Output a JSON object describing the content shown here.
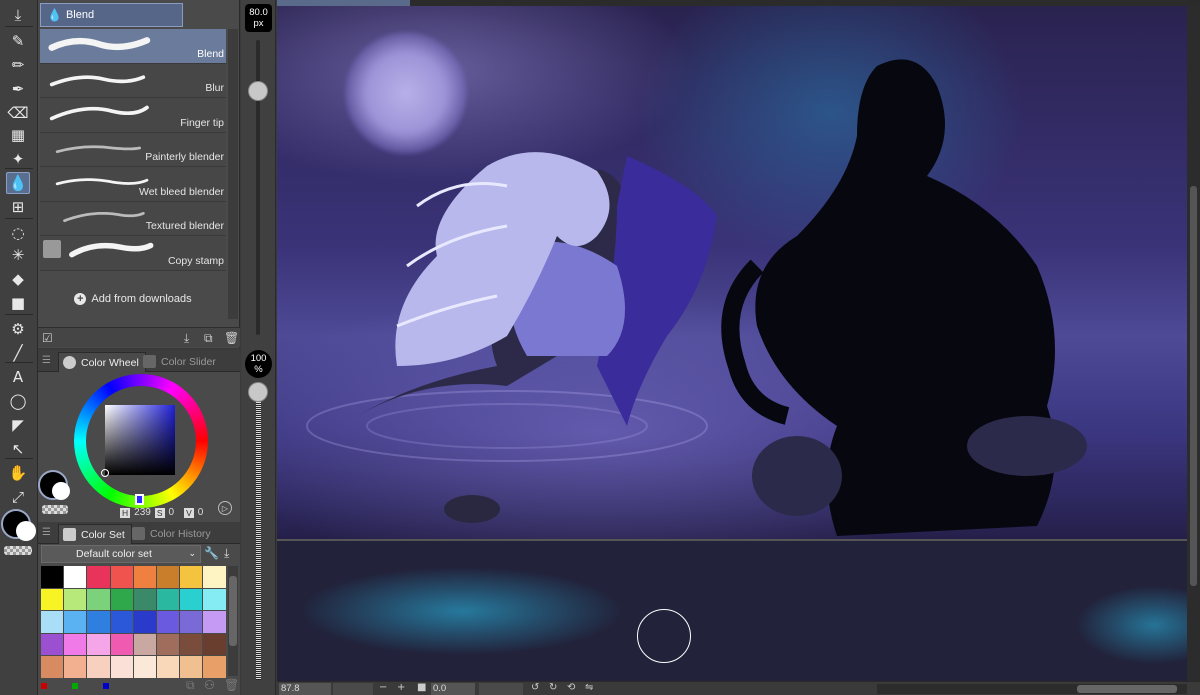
{
  "toolbar": {
    "tools": [
      {
        "name": "download-tool-icon",
        "glyph": "⤓"
      },
      {
        "name": "pen-tool-icon",
        "glyph": "✎"
      },
      {
        "name": "pencil-tool-icon",
        "glyph": "✏"
      },
      {
        "name": "brush-tool-icon",
        "glyph": "✒"
      },
      {
        "name": "eraser-tool-icon",
        "glyph": "⌫"
      },
      {
        "name": "decoration-tool-icon",
        "glyph": "▦"
      },
      {
        "name": "sparkle-tool-icon",
        "glyph": "✦"
      },
      {
        "name": "blend-tool-icon",
        "glyph": "💧"
      },
      {
        "name": "grid-tool-icon",
        "glyph": "⊞"
      },
      {
        "name": "lasso-tool-icon",
        "glyph": "◌"
      },
      {
        "name": "magic-wand-tool-icon",
        "glyph": "✳"
      },
      {
        "name": "fill-tool-icon",
        "glyph": "◆"
      },
      {
        "name": "gradient-tool-icon",
        "glyph": "■"
      },
      {
        "name": "figure-tool-icon",
        "glyph": "⚙"
      },
      {
        "name": "line-tool-icon",
        "glyph": "╱"
      },
      {
        "name": "text-tool-icon",
        "glyph": "A"
      },
      {
        "name": "balloon-tool-icon",
        "glyph": "◯"
      },
      {
        "name": "frame-tool-icon",
        "glyph": "◤"
      },
      {
        "name": "object-tool-icon",
        "glyph": "↖"
      },
      {
        "name": "hand-tool-icon",
        "glyph": "✋"
      },
      {
        "name": "eyedropper-tool-icon",
        "glyph": "⤢"
      }
    ],
    "active_tool": "blend-tool-icon"
  },
  "subtool": {
    "header": "Blend",
    "brushes": [
      {
        "label": "Blend",
        "selected": true
      },
      {
        "label": "Blur",
        "selected": false
      },
      {
        "label": "Finger tip",
        "selected": false
      },
      {
        "label": "Painterly blender",
        "selected": false
      },
      {
        "label": "Wet bleed blender",
        "selected": false
      },
      {
        "label": "Textured blender",
        "selected": false
      },
      {
        "label": "Copy stamp",
        "selected": false
      }
    ],
    "add_from_downloads": "Add from downloads"
  },
  "color_wheel_panel": {
    "tab_active": "Color Wheel",
    "tab_inactive": "Color Slider",
    "h_label": "H",
    "h_value": "239",
    "s_label": "S",
    "s_value": "0",
    "v_label": "V",
    "v_value": "0",
    "current_color": "#000000",
    "sub_color": "#ffffff"
  },
  "color_set_panel": {
    "tab_active": "Color Set",
    "tab_inactive": "Color History",
    "selected_set": "Default color set",
    "swatches": [
      "#000000",
      "#ffffff",
      "#e8335a",
      "#f0524e",
      "#f08040",
      "#c87e2a",
      "#f4c340",
      "#fdf3c3",
      "#f7f324",
      "#b7e87a",
      "#7cd27a",
      "#2fa84c",
      "#3a8a6a",
      "#2ab8a0",
      "#2ad0d0",
      "#86ecf3",
      "#a9dff6",
      "#5ab2f2",
      "#2f7fe0",
      "#2a58d8",
      "#2a3aca",
      "#6a5ae0",
      "#7a6ad8",
      "#c59af4",
      "#9a50d0",
      "#f07ae8",
      "#f5a6e8",
      "#f05ab0",
      "#c8a8a0",
      "#a06c5c",
      "#7a4c3c",
      "#6a3e2e",
      "#d88a60",
      "#f3b090",
      "#f8d0c0",
      "#fbe0d8",
      "#fae8d8",
      "#f8d8b8",
      "#f0c090",
      "#e8a068"
    ]
  },
  "sliders": {
    "brush_size": "80.0\npx",
    "opacity": "100\n%",
    "brush_size_value": 0.25,
    "opacity_value": 1.0
  },
  "statusbar": {
    "zoom": "87.8",
    "angle": "0.0"
  }
}
